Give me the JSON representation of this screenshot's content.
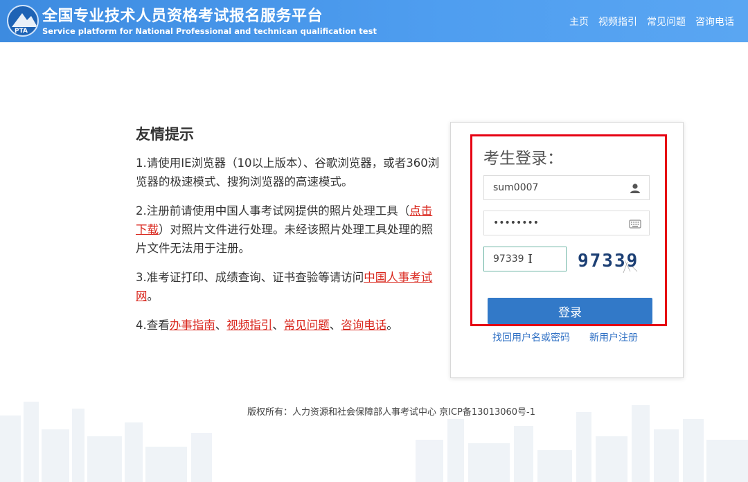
{
  "header": {
    "logo_text": "PTA",
    "title_cn": "全国专业技术人员资格考试报名服务平台",
    "title_en": "Service platform for National Professional and technican qualification test",
    "nav": [
      "主页",
      "视频指引",
      "常见问题",
      "咨询电话"
    ]
  },
  "tips": {
    "heading": "友情提示",
    "item1": "1.请使用IE浏览器（10以上版本）、谷歌浏览器，或者360浏览器的极速模式、搜狗浏览器的高速模式。",
    "item2_a": "2.注册前请使用中国人事考试网提供的照片处理工具（",
    "item2_link": "点击下载",
    "item2_b": "）对照片文件进行处理。未经该照片处理工具处理的照片文件无法用于注册。",
    "item3_a": "3.准考证打印、成绩查询、证书查验等请访问",
    "item3_link": "中国人事考试网",
    "item3_b": "。",
    "item4_a": "4.查看",
    "item4_links": [
      "办事指南",
      "视频指引",
      "常见问题",
      "咨询电话"
    ],
    "item4_sep": "、",
    "item4_end": "。"
  },
  "login": {
    "title": "考生登录：",
    "username_value": "sum0007",
    "password_value": "••••••••",
    "captcha_value": "97339",
    "captcha_image_text": "97339",
    "submit_label": "登录",
    "recover_link": "找回用户名或密码",
    "register_link": "新用户注册"
  },
  "footer": {
    "text": "版权所有：人力资源和社会保障部人事考试中心 京ICP备13013060号-1"
  },
  "colors": {
    "header": "#4f9ef0",
    "link_red": "#d9261c",
    "button": "#3279c8",
    "highlight_box": "#e60012"
  }
}
